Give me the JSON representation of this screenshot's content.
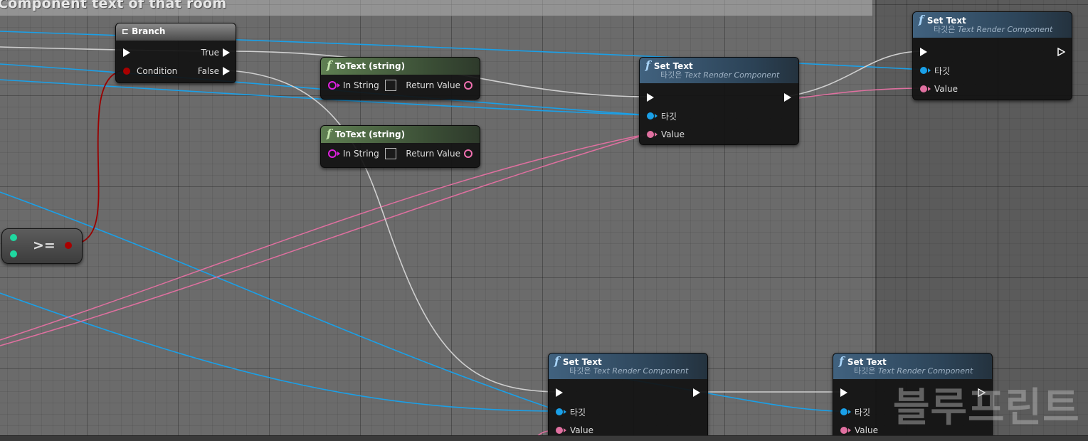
{
  "comment": {
    "title": "Component text of that room"
  },
  "watermark": "블루프린트",
  "nodes": {
    "branch": {
      "title": "Branch",
      "condition": "Condition",
      "true_label": "True",
      "false_label": "False"
    },
    "totext_1": {
      "title": "ToText (string)",
      "input": "In String",
      "output": "Return Value"
    },
    "totext_2": {
      "title": "ToText (string)",
      "input": "In String",
      "output": "Return Value"
    },
    "compare": {
      "label": ">="
    },
    "settext_1": {
      "title": "Set Text",
      "target_prefix": "타깃은",
      "target_class": "Text Render Component",
      "target_pin": "타깃",
      "value_pin": "Value"
    },
    "settext_2": {
      "title": "Set Text",
      "target_prefix": "타깃은",
      "target_class": "Text Render Component",
      "target_pin": "타깃",
      "value_pin": "Value"
    },
    "settext_3": {
      "title": "Set Text",
      "target_prefix": "타깃은",
      "target_class": "Text Render Component",
      "target_pin": "타깃",
      "value_pin": "Value"
    },
    "settext_4": {
      "title": "Set Text",
      "target_prefix": "타깃은",
      "target_class": "Text Render Component",
      "target_pin": "타깃",
      "value_pin": "Value"
    }
  },
  "icons": {
    "function": "function-icon",
    "branch": "branch-icon"
  },
  "colors": {
    "exec_wire": "#cfcfcf",
    "object_wire": "#1aa0e8",
    "text_wire": "#e070a0",
    "bool_wire": "#990000",
    "int_pin": "#1fd8a0",
    "string_pin": "#e020e0"
  }
}
